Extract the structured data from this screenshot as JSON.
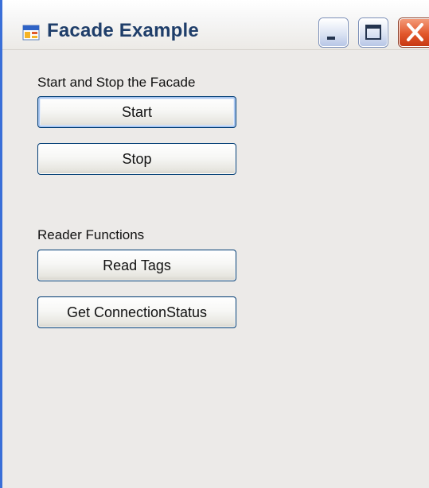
{
  "window": {
    "title": "Facade Example",
    "icon": "windows-forms-app-icon",
    "caption_buttons": [
      "minimize-icon",
      "maximize-icon",
      "close-icon"
    ]
  },
  "groups": {
    "facade": {
      "label": "Start and Stop the Facade",
      "start_label": "Start",
      "stop_label": "Stop"
    },
    "reader": {
      "label": "Reader Functions",
      "read_tags_label": "Read Tags",
      "connection_status_label": "Get ConnectionStatus"
    }
  },
  "colors": {
    "title_text": "#1f3e6a",
    "button_border": "#003c74",
    "close_button": "#e2572c",
    "client_background": "#eceae8"
  }
}
